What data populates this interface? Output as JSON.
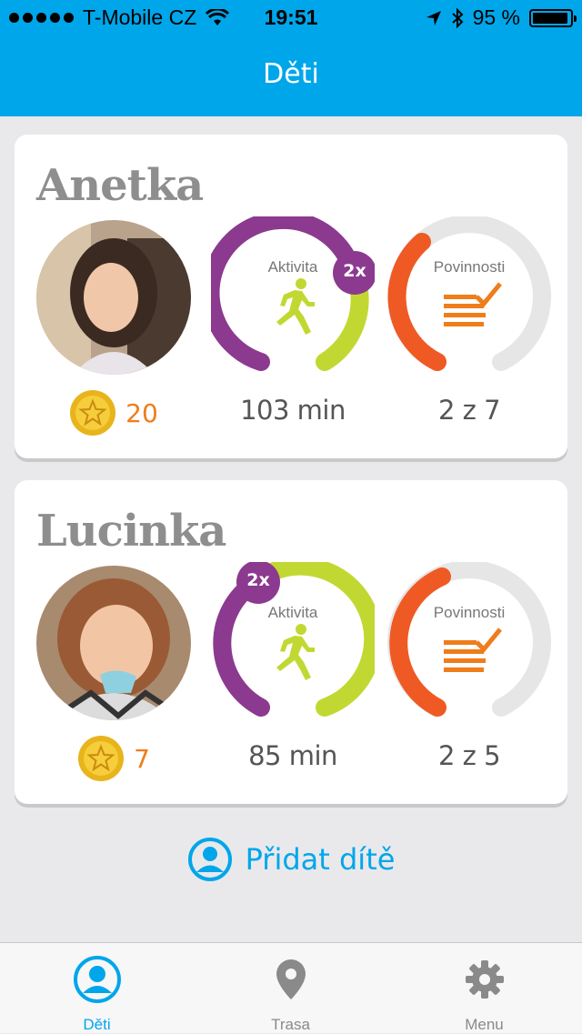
{
  "status_bar": {
    "carrier": "T-Mobile CZ",
    "time": "19:51",
    "battery": "95 %",
    "battery_level": 0.95
  },
  "nav": {
    "title": "Děti"
  },
  "children": [
    {
      "name": "Anetka",
      "coins": "20",
      "activity": {
        "title": "Aktivita",
        "badge": "2x",
        "value": "103 min"
      },
      "duties": {
        "title": "Povinnosti",
        "value": "2 z 7"
      }
    },
    {
      "name": "Lucinka",
      "coins": "7",
      "activity": {
        "title": "Aktivita",
        "badge": "2x",
        "value": "85 min"
      },
      "duties": {
        "title": "Povinnosti",
        "value": "2 z 5"
      }
    }
  ],
  "add_child": {
    "label": "Přidat dítě"
  },
  "tabbar": {
    "tabs": [
      {
        "label": "Děti",
        "icon": "user-icon"
      },
      {
        "label": "Trasa",
        "icon": "map-pin-icon"
      },
      {
        "label": "Menu",
        "icon": "gear-icon"
      }
    ]
  },
  "colors": {
    "brand": "#00a6ea",
    "activity_purple": "#8b3a8f",
    "activity_green": "#c2d832",
    "duties_orange": "#ef5a24",
    "coin_orange": "#ef7d1a"
  }
}
